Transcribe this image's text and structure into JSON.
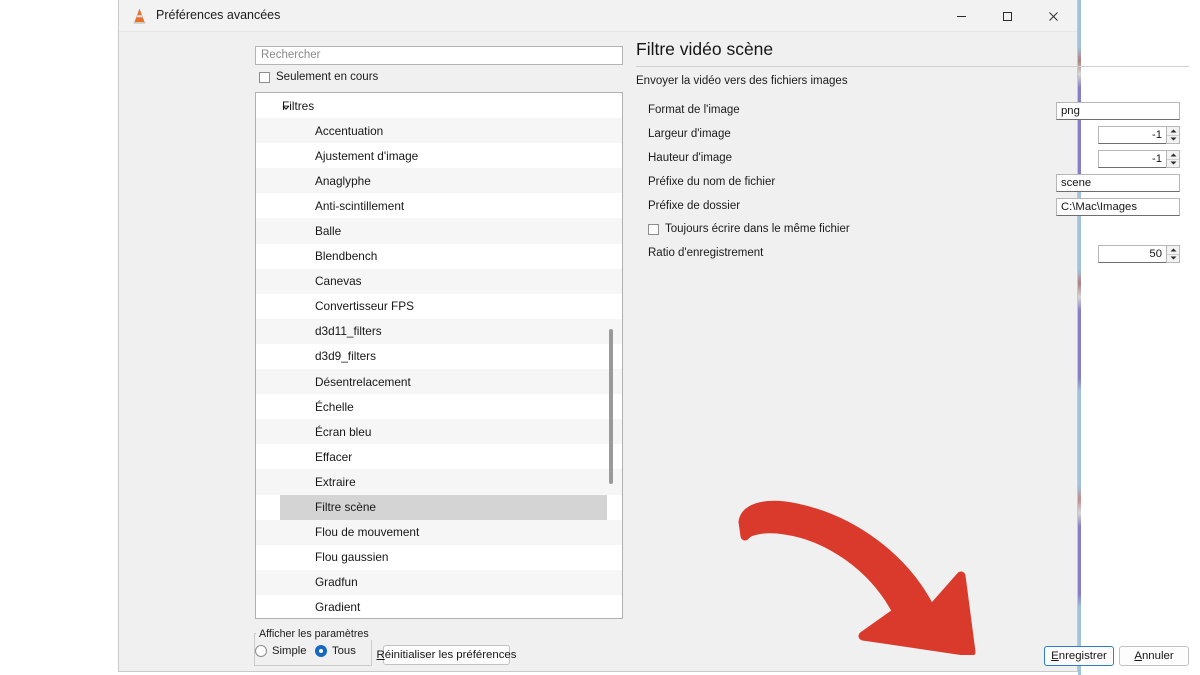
{
  "window": {
    "title": "Préférences avancées",
    "icon": "vlc-cone-icon",
    "controls": {
      "minimize": "minimize-icon",
      "maximize": "maximize-icon",
      "close": "close-icon"
    }
  },
  "left_pane": {
    "search": {
      "placeholder": "Rechercher",
      "value": ""
    },
    "only_current": {
      "label": "Seulement en cours",
      "checked": false
    },
    "tree": {
      "root": {
        "label": "Filtres",
        "expanded": true,
        "chevron": "chevron-down-icon"
      },
      "items": [
        "Accentuation",
        "Ajustement d'image",
        "Anaglyphe",
        "Anti-scintillement",
        "Balle",
        "Blendbench",
        "Canevas",
        "Convertisseur FPS",
        "d3d11_filters",
        "d3d9_filters",
        "Désentrelacement",
        "Échelle",
        "Écran bleu",
        "Effacer",
        "Extraire",
        "Filtre scène",
        "Flou de mouvement",
        "Flou gaussien",
        "Gradfun",
        "Gradient"
      ],
      "selected": "Filtre scène"
    }
  },
  "footer": {
    "group_title": "Afficher les paramètres",
    "radios": [
      {
        "label": "Simple",
        "selected": false
      },
      {
        "label": "Tous",
        "selected": true
      }
    ],
    "reset_button": "Réinitialiser les préférences",
    "save_button": "Enregistrer",
    "cancel_button": "Annuler"
  },
  "right_pane": {
    "title": "Filtre vidéo scène",
    "subtitle": "Envoyer la vidéo vers des fichiers images",
    "fields": [
      {
        "label": "Format de l'image",
        "value": "png",
        "type": "text",
        "align": "left"
      },
      {
        "label": "Largeur d'image",
        "value": "-1",
        "type": "spin"
      },
      {
        "label": "Hauteur d'image",
        "value": "-1",
        "type": "spin"
      },
      {
        "label": "Préfixe du nom de fichier",
        "value": "scene",
        "type": "text",
        "align": "left"
      },
      {
        "label": "Préfixe de dossier",
        "value": "C:\\Mac\\Images",
        "type": "text",
        "align": "left"
      },
      {
        "label": "Ratio d'enregistrement",
        "value": "50",
        "type": "spin"
      }
    ],
    "same_file_checkbox": {
      "label": "Toujours écrire dans le même fichier",
      "checked": false
    }
  },
  "annotation": {
    "arrow": "red-curved-arrow",
    "color": "#d93a2b",
    "points_to": "Enregistrer"
  }
}
